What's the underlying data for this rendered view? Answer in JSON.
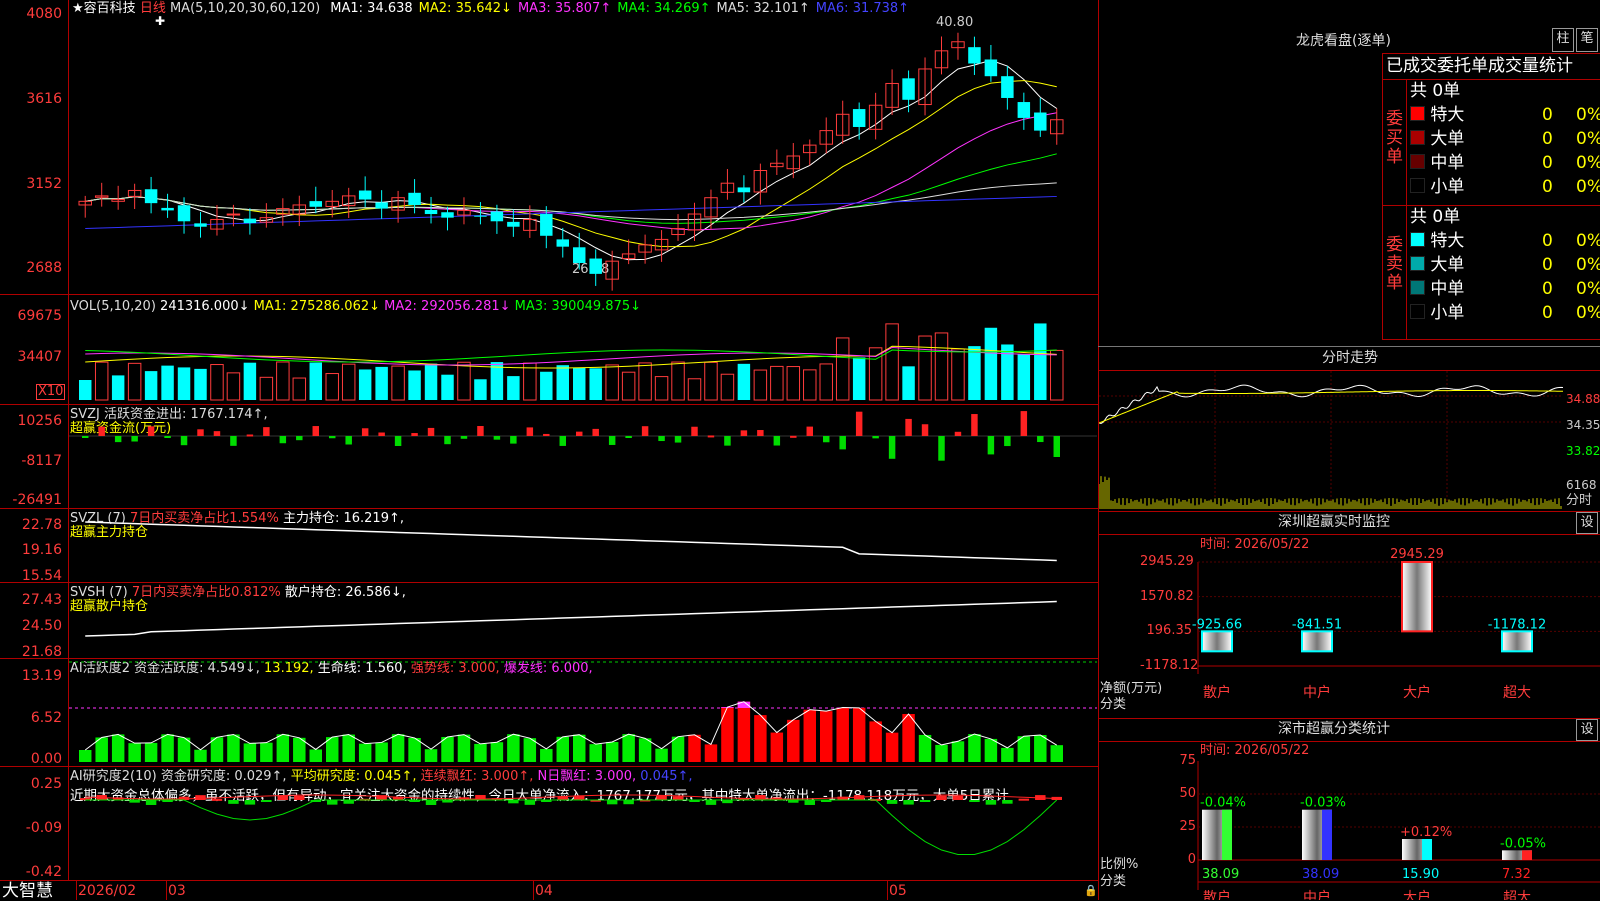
{
  "stock": {
    "star": "★",
    "name": "容百科技",
    "period": "日线",
    "ma_label": "MA(5,10,20,30,60,120)",
    "ma": [
      {
        "label": "MA1: 34.638",
        "color": "#ffffff"
      },
      {
        "label": "MA2: 35.642↓",
        "color": "#ffff00"
      },
      {
        "label": "MA3: 35.807↑",
        "color": "#ff33ff"
      },
      {
        "label": "MA4: 34.269↑",
        "color": "#00ff00"
      },
      {
        "label": "MA5: 32.101↑",
        "color": "#dddddd"
      },
      {
        "label": "MA6: 31.738↑",
        "color": "#4444ff"
      }
    ],
    "high_label": "40.80",
    "low_label": "26.88",
    "axis": [
      "4080",
      "3616",
      "3152",
      "2688"
    ]
  },
  "vol": {
    "header": "VOL(5,10,20)",
    "value": "241316.000↓",
    "ma1": "MA1: 275286.062↓",
    "ma2": "MA2: 292056.281↓",
    "ma3": "MA3: 390049.875↓",
    "axis": [
      "69675",
      "34407"
    ],
    "unit": "X10"
  },
  "svzj": {
    "header": "SVZJ  活跃资金进出: 1767.174↑,",
    "sub": "超赢资金流(万元)",
    "axis": [
      "10256",
      "-8117",
      "-26491"
    ]
  },
  "svzl": {
    "header_a": "SVZL (7)",
    "header_b": "7日内买卖净占比1.554%",
    "header_c": "主力持仓: 16.219↑,",
    "sub": "超赢主力持仓",
    "axis": [
      "22.78",
      "19.16",
      "15.54"
    ]
  },
  "svsh": {
    "header_a": "SVSH (7)",
    "header_b": "7日内买卖净占比0.812%",
    "header_c": "散户持仓: 26.586↓,",
    "sub": "超赢散户持仓",
    "axis": [
      "27.43",
      "24.50",
      "21.68"
    ]
  },
  "ai1": {
    "h1": "AI活跃度2 资金活跃度: 4.549↓,",
    "h2": "13.192,",
    "h3": "生命线: 1.560,",
    "h4": "强势线: 3.000,",
    "h5": "爆发线: 6.000,",
    "axis": [
      "13.19",
      "6.52",
      "0.00"
    ]
  },
  "ai2": {
    "h1": "AI研究度2(10) 资金研究度: 0.029↑,",
    "h2": "平均研究度: 0.045↑,",
    "h3": "连续飘红: 3.000↑,",
    "h4": "N日飘红: 3.000,",
    "h5": "0.045↑,",
    "comment": "近期大资金总体偏多，虽不活跃，但有异动，宜关注大资金的持续性，今日大单净流入：1767.177万元，其中特大单净流出：-1178.118万元，大单5日累计",
    "axis": [
      "0.25",
      "-0.09",
      "-0.42"
    ]
  },
  "timeline": {
    "brand": "大智慧",
    "labels": [
      "2026/02",
      "03",
      "04",
      "05"
    ]
  },
  "dragon": {
    "title": "龙虎看盘(逐单)",
    "btn_zhu": "柱",
    "btn_bi": "笔",
    "head": "已成交委托单成交量统计",
    "buy_label": "委买单",
    "sell_label": "委卖单",
    "buy_total": "共 0单",
    "sell_total": "共 0单",
    "buy_rows": [
      {
        "name": "特大",
        "val": "0",
        "pct": "0%",
        "color": "#ff0000"
      },
      {
        "name": "大单",
        "val": "0",
        "pct": "0%",
        "color": "#aa0000"
      },
      {
        "name": "中单",
        "val": "0",
        "pct": "0%",
        "color": "#660000"
      },
      {
        "name": "小单",
        "val": "0",
        "pct": "0%",
        "color": "#000000"
      }
    ],
    "sell_rows": [
      {
        "name": "特大",
        "val": "0",
        "pct": "0%",
        "color": "#00ffff"
      },
      {
        "name": "大单",
        "val": "0",
        "pct": "0%",
        "color": "#00aaaa"
      },
      {
        "name": "中单",
        "val": "0",
        "pct": "0%",
        "color": "#007777"
      },
      {
        "name": "小单",
        "val": "0",
        "pct": "0%",
        "color": "#000000"
      }
    ]
  },
  "intraday": {
    "title": "分时走势",
    "axis": [
      "34.88",
      "34.35",
      "33.82",
      "6168"
    ],
    "unit": "分时"
  },
  "monitor": {
    "title": "深圳超赢实时监控",
    "btn": "设",
    "time": "时间: 2026/05/22",
    "axis": [
      "2945.29",
      "1570.82",
      "196.35",
      "-1178.12"
    ],
    "ylabel": "净额(万元)",
    "xlabel": "分类",
    "categories": [
      "散户",
      "中户",
      "大户",
      "超大"
    ],
    "values": [
      -925.66,
      -841.51,
      2945.29,
      -1178.12
    ],
    "value_labels": [
      "-925.66",
      "-841.51",
      "2945.29",
      "-1178.12"
    ]
  },
  "classify": {
    "title": "深市超赢分类统计",
    "btn": "设",
    "time": "时间: 2026/05/22",
    "axis": [
      "75",
      "50",
      "25",
      "0"
    ],
    "ylabel": "比例%",
    "xlabel": "分类",
    "categories": [
      "散户",
      "中户",
      "大户",
      "超大"
    ],
    "values": [
      38.09,
      38.09,
      15.9,
      7.32
    ],
    "value_labels": [
      "38.09",
      "38.09",
      "15.90",
      "7.32"
    ],
    "change_labels": [
      "-0.04%",
      "-0.03%",
      "+0.12%",
      "-0.05%"
    ],
    "bar_colors": [
      "#33ff33",
      "#3333ff",
      "#00ffff",
      "#ff2222"
    ]
  }
}
